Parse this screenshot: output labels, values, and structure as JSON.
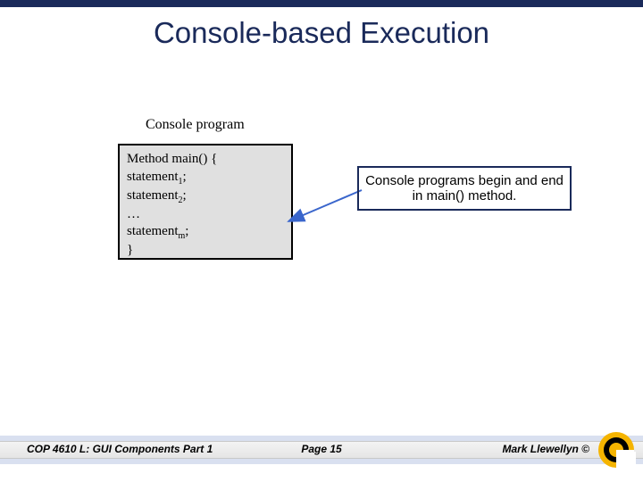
{
  "slide": {
    "title": "Console-based Execution",
    "program_label": "Console program",
    "code": {
      "line1": "Method main() {",
      "stmt1_prefix": "statement",
      "stmt1_sub": "1",
      "stmt1_suffix": ";",
      "stmt2_prefix": "statement",
      "stmt2_sub": "2",
      "stmt2_suffix": ";",
      "ellipsis": "…",
      "stmtm_prefix": "statement",
      "stmtm_sub": "m",
      "stmtm_suffix": ";",
      "close": "}"
    },
    "callout": "Console programs begin and end in main() method."
  },
  "footer": {
    "left": "COP 4610 L: GUI Components Part 1",
    "center": "Page 15",
    "right": "Mark Llewellyn ©"
  },
  "colors": {
    "brand": "#1a2a5a",
    "gold": "#f5b400"
  }
}
